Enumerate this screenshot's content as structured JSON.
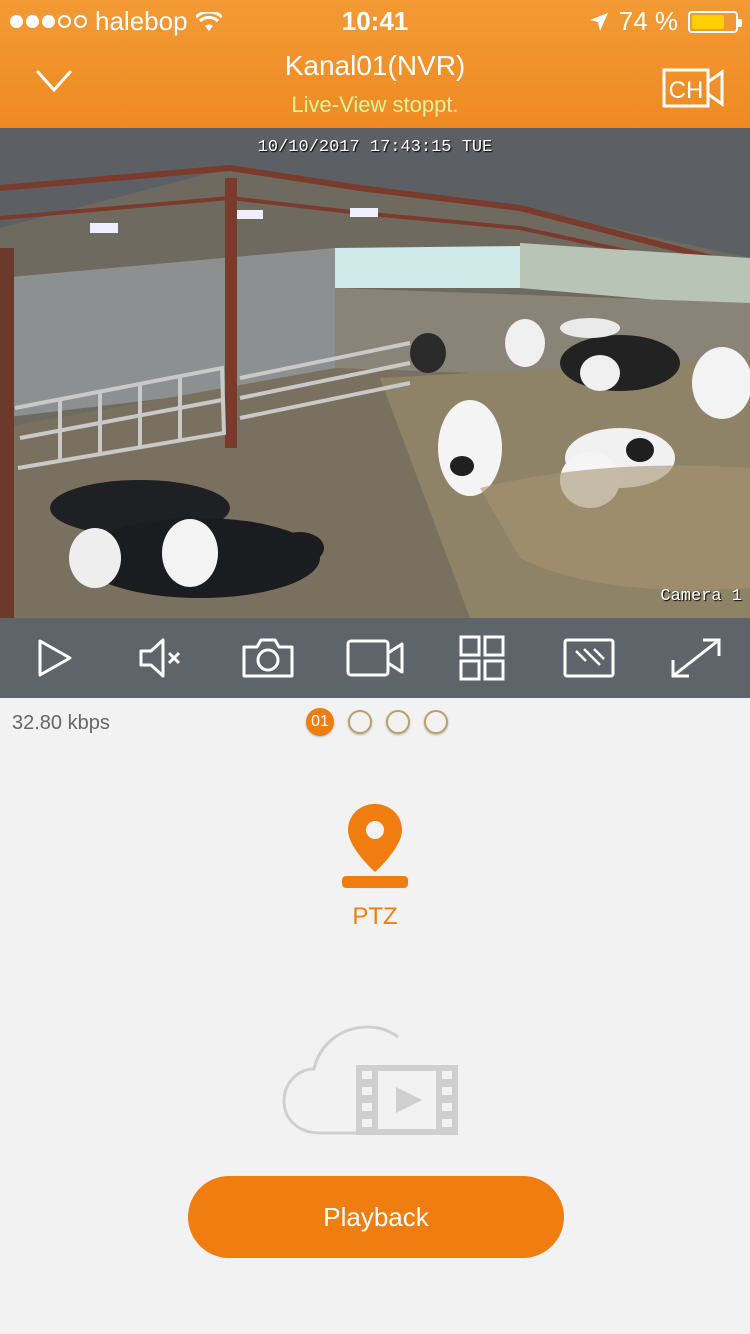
{
  "status_bar": {
    "carrier": "halebop",
    "time": "10:41",
    "battery_text": "74 %",
    "signal_bars_filled": 3,
    "signal_bars_total": 5,
    "icons": [
      "wifi-icon",
      "location-arrow-icon",
      "battery-icon"
    ]
  },
  "nav": {
    "title": "Kanal01(NVR)",
    "subtitle": "Live-View stoppt.",
    "ch_label": "CH"
  },
  "video": {
    "timestamp": "10/10/2017 17:43:15 TUE",
    "camera_label": "Camera 1"
  },
  "toolbar": {
    "icons": [
      "play-icon",
      "mute-icon",
      "snapshot-icon",
      "record-icon",
      "grid-layout-icon",
      "stream-quality-icon",
      "fullscreen-icon"
    ]
  },
  "info": {
    "bitrate": "32.80 kbps",
    "pages": [
      "01",
      "",
      "",
      ""
    ],
    "active_page": 0
  },
  "ptz": {
    "label": "PTZ"
  },
  "playback": {
    "button_label": "Playback"
  },
  "colors": {
    "accent": "#ef7d10",
    "header": "#f2922c",
    "toolbar": "#5f646a",
    "subtitle": "#d9f59a"
  }
}
